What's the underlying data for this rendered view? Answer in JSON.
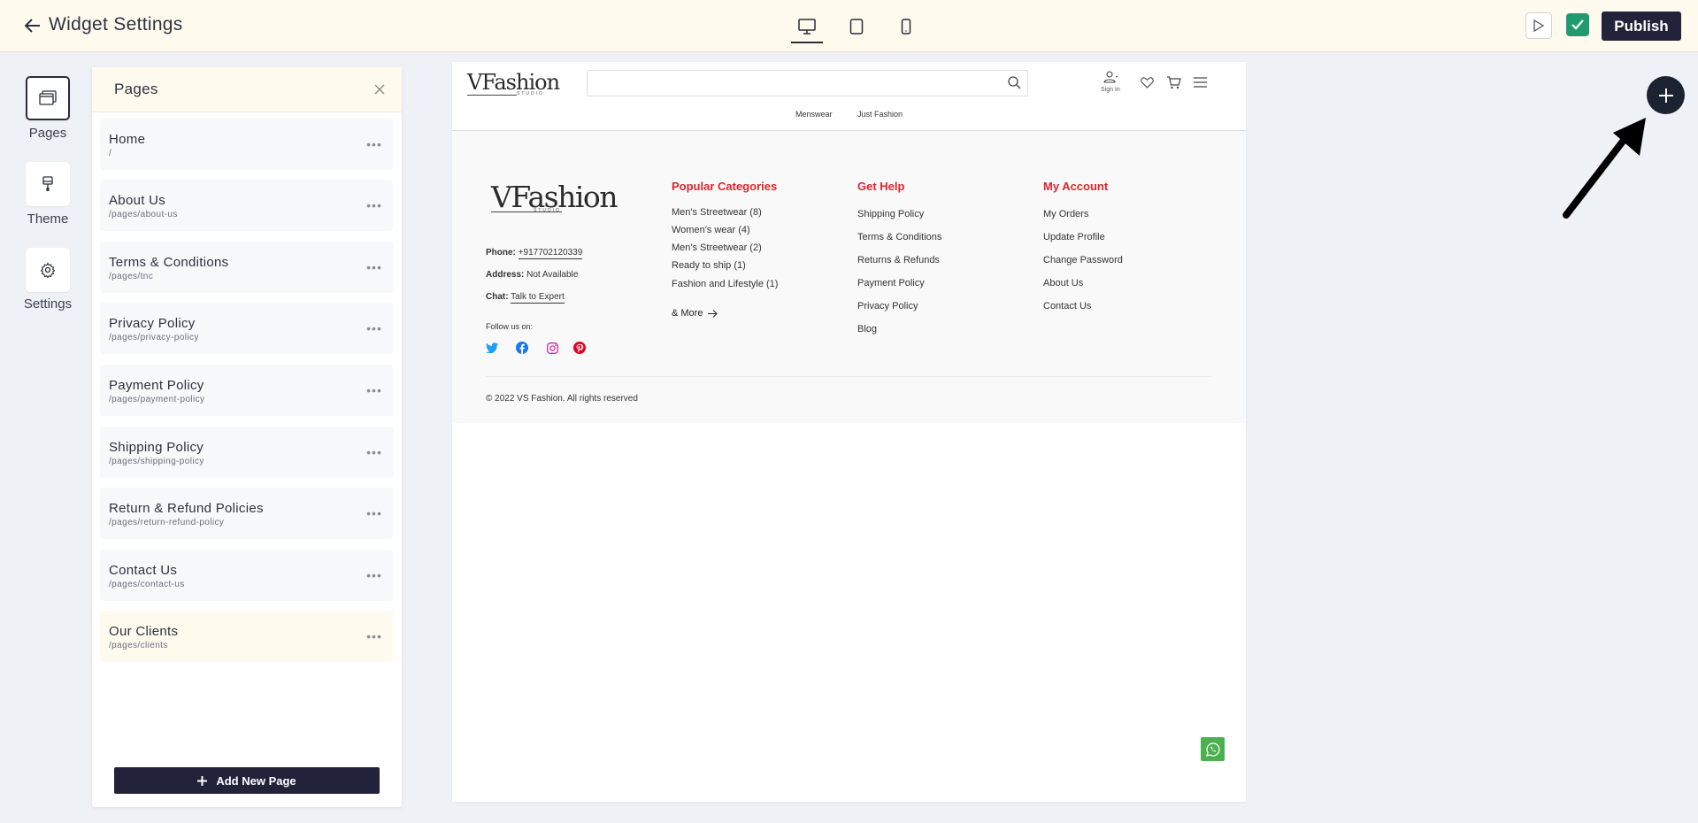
{
  "topbar": {
    "title": "Widget Settings",
    "publish_label": "Publish"
  },
  "rail": {
    "items": [
      {
        "label": "Pages",
        "icon": "pages-icon"
      },
      {
        "label": "Theme",
        "icon": "brush-icon"
      },
      {
        "label": "Settings",
        "icon": "gear-icon"
      }
    ]
  },
  "pages_panel": {
    "title": "Pages",
    "items": [
      {
        "name": "Home",
        "path": "/"
      },
      {
        "name": "About Us",
        "path": "/pages/about-us"
      },
      {
        "name": "Terms & Conditions",
        "path": "/pages/tnc"
      },
      {
        "name": "Privacy Policy",
        "path": "/pages/privacy-policy"
      },
      {
        "name": "Payment Policy",
        "path": "/pages/payment-policy"
      },
      {
        "name": "Shipping Policy",
        "path": "/pages/shipping-policy"
      },
      {
        "name": "Return & Refund Policies",
        "path": "/pages/return-refund-policy"
      },
      {
        "name": "Contact Us",
        "path": "/pages/contact-us"
      },
      {
        "name": "Our Clients",
        "path": "/pages/clients"
      }
    ],
    "add_label": "Add New Page"
  },
  "site": {
    "logo_text": "VFashion",
    "logo_sub": "STUDIO",
    "search_placeholder": "",
    "signin_label": "Sign In",
    "nav": [
      "Menswear",
      "Just Fashion"
    ],
    "footer": {
      "phone_label": "Phone:",
      "phone_value": "+917702120339",
      "address_label": "Address:",
      "address_value": "Not Available",
      "chat_label": "Chat:",
      "chat_value": "Talk to Expert",
      "follow_label": "Follow us on:",
      "columns": [
        {
          "heading": "Popular Categories",
          "links": [
            "Men's Streetwear (8)",
            "Women's wear (4)",
            "Men's Streetwear (2)",
            "Ready to ship (1)",
            "Fashion and Lifestyle (1)"
          ]
        },
        {
          "heading": "Get Help",
          "links": [
            "Shipping Policy",
            "Terms & Conditions",
            "Returns & Refunds",
            "Payment Policy",
            "Privacy Policy",
            "Blog"
          ]
        },
        {
          "heading": "My Account",
          "links": [
            "My Orders",
            "Update Profile",
            "Change Password",
            "About Us",
            "Contact Us"
          ]
        }
      ],
      "more_label": "& More",
      "copyright": "© 2022 VS Fashion. All rights reserved"
    }
  },
  "colors": {
    "accent_dark": "#22223a",
    "topbar_bg": "#fefbee",
    "footer_heading": "#e0242e",
    "confirm_green": "#1f9b6f",
    "whatsapp_green": "#4caf50"
  }
}
